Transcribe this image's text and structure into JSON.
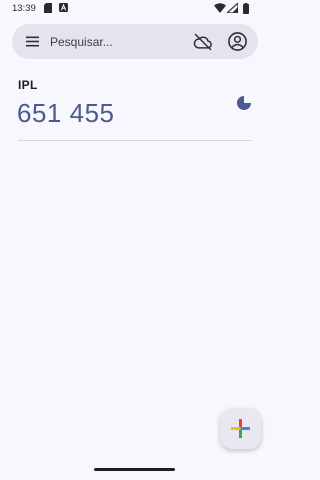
{
  "status_bar": {
    "time": "13:39",
    "icons": [
      "sim-card-icon",
      "a-notification-icon",
      "wifi-icon",
      "signal-icon",
      "battery-icon"
    ]
  },
  "search": {
    "placeholder": "Pesquisar...",
    "menu_icon": "hamburger-menu-icon",
    "cloud_icon": "cloud-off-icon",
    "account_icon": "account-circle-icon"
  },
  "entries": [
    {
      "issuer": "IPL",
      "code": "651 455",
      "timer_icon": "countdown-pie-icon",
      "timer_color": "#4a5c8e"
    }
  ],
  "fab": {
    "icon": "google-plus-icon",
    "colors": [
      "#ea4335",
      "#4285f4",
      "#fbbc04",
      "#34a853"
    ]
  }
}
